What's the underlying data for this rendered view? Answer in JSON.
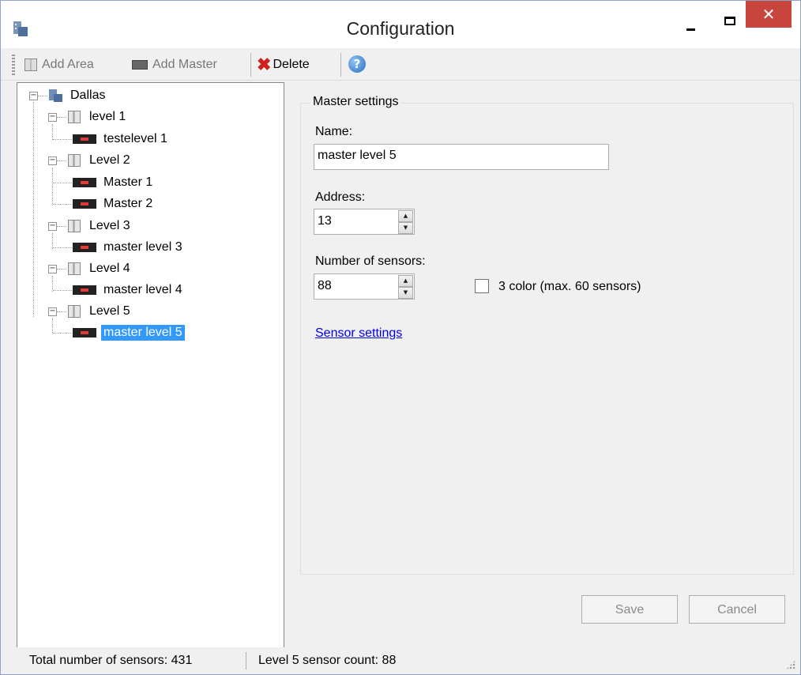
{
  "window": {
    "title": "Configuration",
    "close_glyph": "✕"
  },
  "toolbar": {
    "add_area_label": "Add Area",
    "add_master_label": "Add Master",
    "delete_label": "Delete",
    "help_glyph": "?"
  },
  "tree": {
    "root": "Dallas",
    "areas": [
      {
        "label": "level 1",
        "masters": [
          "testelevel 1"
        ]
      },
      {
        "label": "Level 2",
        "masters": [
          "Master  1",
          "Master 2"
        ]
      },
      {
        "label": "Level 3",
        "masters": [
          "master level 3"
        ]
      },
      {
        "label": "Level 4",
        "masters": [
          "master level 4"
        ]
      },
      {
        "label": "Level 5",
        "masters": [
          "master level 5"
        ]
      }
    ],
    "selected": "master level 5"
  },
  "master_settings": {
    "group_title": "Master settings",
    "name_label": "Name:",
    "name_value": "master level 5",
    "address_label": "Address:",
    "address_value": "13",
    "sensors_label": "Number of sensors:",
    "sensors_value": "88",
    "three_color_label": "3 color (max. 60 sensors)",
    "three_color_checked": false,
    "sensor_settings_link": "Sensor settings"
  },
  "buttons": {
    "save_label": "Save",
    "cancel_label": "Cancel"
  },
  "statusbar": {
    "total_sensors": "Total number of sensors: 431",
    "level_count": "Level 5 sensor count: 88"
  },
  "colors": {
    "selection": "#3399ff",
    "close_button": "#c7453c",
    "link": "#0000ee"
  }
}
